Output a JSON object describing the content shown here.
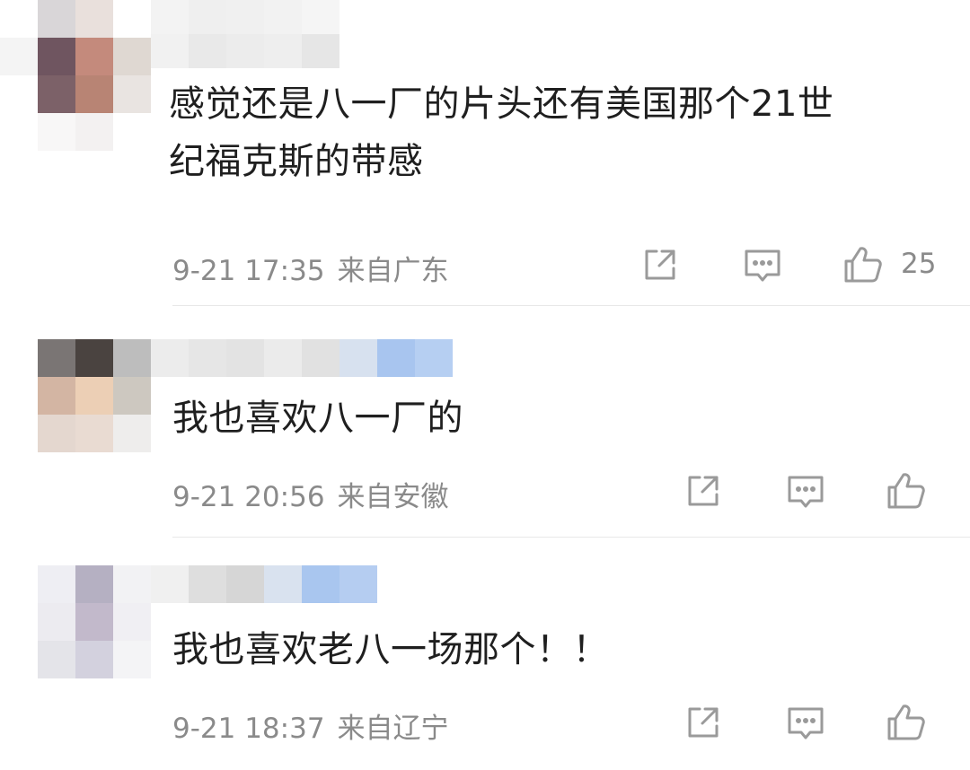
{
  "comments": [
    {
      "text": "感觉还是八一厂的片头还有美国那个21世\n纪福克斯的带感",
      "date": "9-21 17:35",
      "location": "来自广东",
      "like_count": "25"
    },
    {
      "text": "我也喜欢八一厂的",
      "date": "9-21 20:56",
      "location": "来自安徽",
      "like_count": ""
    },
    {
      "text": "我也喜欢老八一场那个！！",
      "date": "9-21 18:37",
      "location": "来自辽宁",
      "like_count": ""
    }
  ],
  "colors": {
    "meta_text": "#8a8a8a",
    "icon_stroke": "#9a9a9a",
    "divider": "#e8e8e8"
  }
}
